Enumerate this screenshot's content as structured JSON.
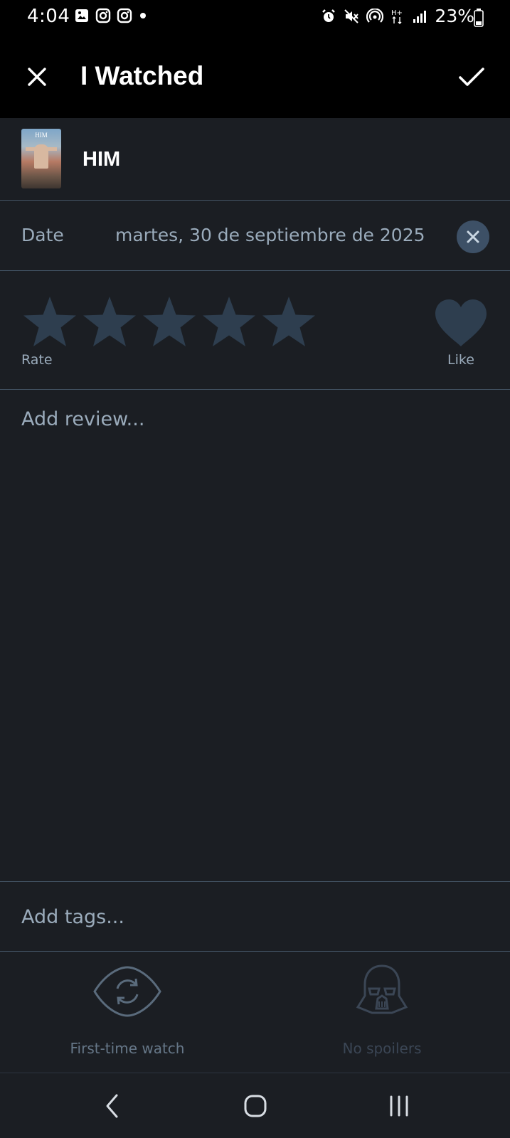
{
  "status_bar": {
    "time": "4:04",
    "battery": "23%",
    "left_icons": [
      "gallery-icon",
      "instagram-icon",
      "instagram-icon",
      "dot-icon"
    ],
    "right_icons": [
      "alarm-icon",
      "mute-icon",
      "hotspot-icon",
      "network-hplus-icon",
      "signal-icon",
      "battery-icon"
    ]
  },
  "app_bar": {
    "title": "I Watched",
    "close_icon": "close-icon",
    "confirm_icon": "check-icon"
  },
  "film": {
    "title": "HIM",
    "poster_text": "HIM"
  },
  "date": {
    "label": "Date",
    "value": "martes, 30 de septiembre de 2025"
  },
  "rating": {
    "label": "Rate",
    "stars_total": 5,
    "stars_filled": 0,
    "like_label": "Like",
    "liked": false
  },
  "review": {
    "placeholder": "Add review..."
  },
  "tags": {
    "placeholder": "Add tags..."
  },
  "toggles": {
    "first_time": {
      "label": "First-time watch",
      "icon": "rewatch-eye-icon"
    },
    "spoilers": {
      "label": "No spoilers",
      "icon": "darth-vader-helmet-icon"
    }
  },
  "colors": {
    "background": "#1b1e23",
    "header": "#000000",
    "star_empty": "#2e3e4f",
    "divider": "#445566",
    "muted_text": "#9aabbb"
  }
}
